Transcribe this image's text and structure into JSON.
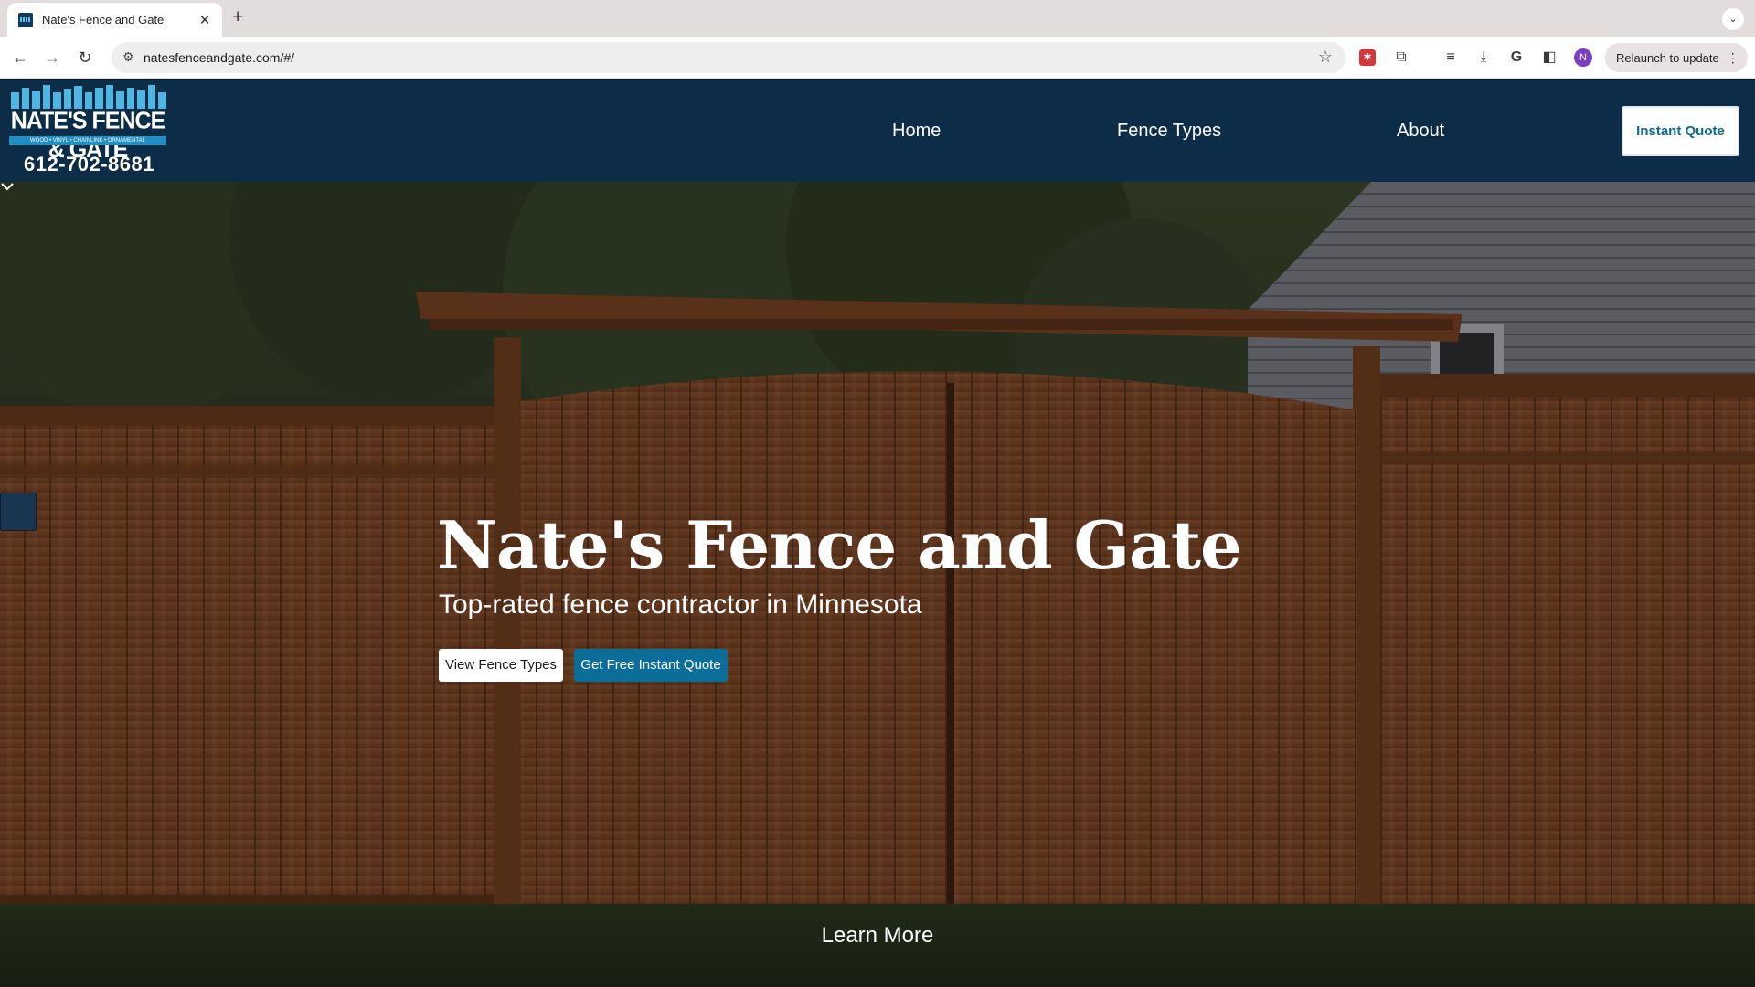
{
  "browser": {
    "tab_title": "Nate's Fence and Gate",
    "new_tab": "+",
    "url": "natesfenceandgate.com/#/",
    "profile_initial": "N",
    "relaunch_label": "Relaunch to update"
  },
  "header": {
    "logo_name": "NATE'S FENCE & GATE",
    "logo_tagline": "WOOD • VINYL • CHAINLINK • ORNAMENTAL",
    "phone": "612-702-8681",
    "nav": [
      "Home",
      "Fence Types",
      "About"
    ],
    "cta": "Instant Quote"
  },
  "hero": {
    "title": "Nate's Fence and Gate",
    "subtitle": "Top-rated fence contractor in Minnesota",
    "primary_button": "View Fence Types",
    "secondary_button": "Get Free Instant Quote",
    "learn_more": "Learn More"
  },
  "colors": {
    "header_bg": "#0d2c47",
    "accent": "#0b6e9a",
    "logo_blue": "#4fb6e2",
    "fence_wood": "#8a4e2a"
  }
}
